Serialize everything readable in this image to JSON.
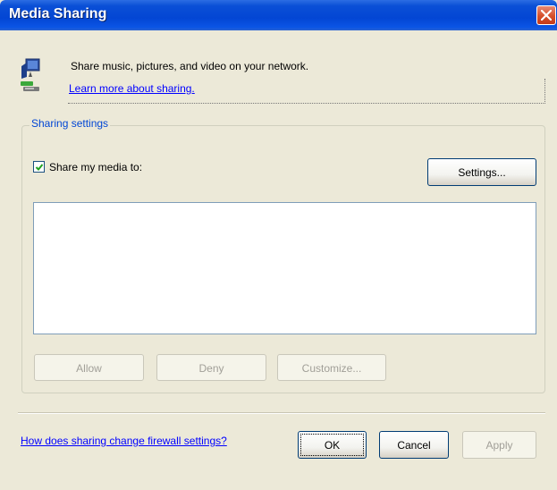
{
  "window": {
    "title": "Media Sharing",
    "close_glyph": "✕"
  },
  "header": {
    "description": "Share music, pictures, and video on your network.",
    "learn_more_link": "Learn more about sharing.",
    "icon": "network-media-icon"
  },
  "sharing_settings": {
    "group_title": "Sharing settings",
    "share_checkbox": {
      "label": "Share my media to:",
      "checked": true
    },
    "settings_button": "Settings...",
    "devices": [],
    "allow_button": "Allow",
    "deny_button": "Deny",
    "customize_button": "Customize..."
  },
  "footer": {
    "firewall_link": "How does sharing change firewall settings?",
    "ok_button": "OK",
    "cancel_button": "Cancel",
    "apply_button": "Apply"
  },
  "colors": {
    "title_bar": "#0346d4",
    "link": "#0000ff",
    "group_title": "#0046d5",
    "dialog_bg": "#ece9d8"
  }
}
